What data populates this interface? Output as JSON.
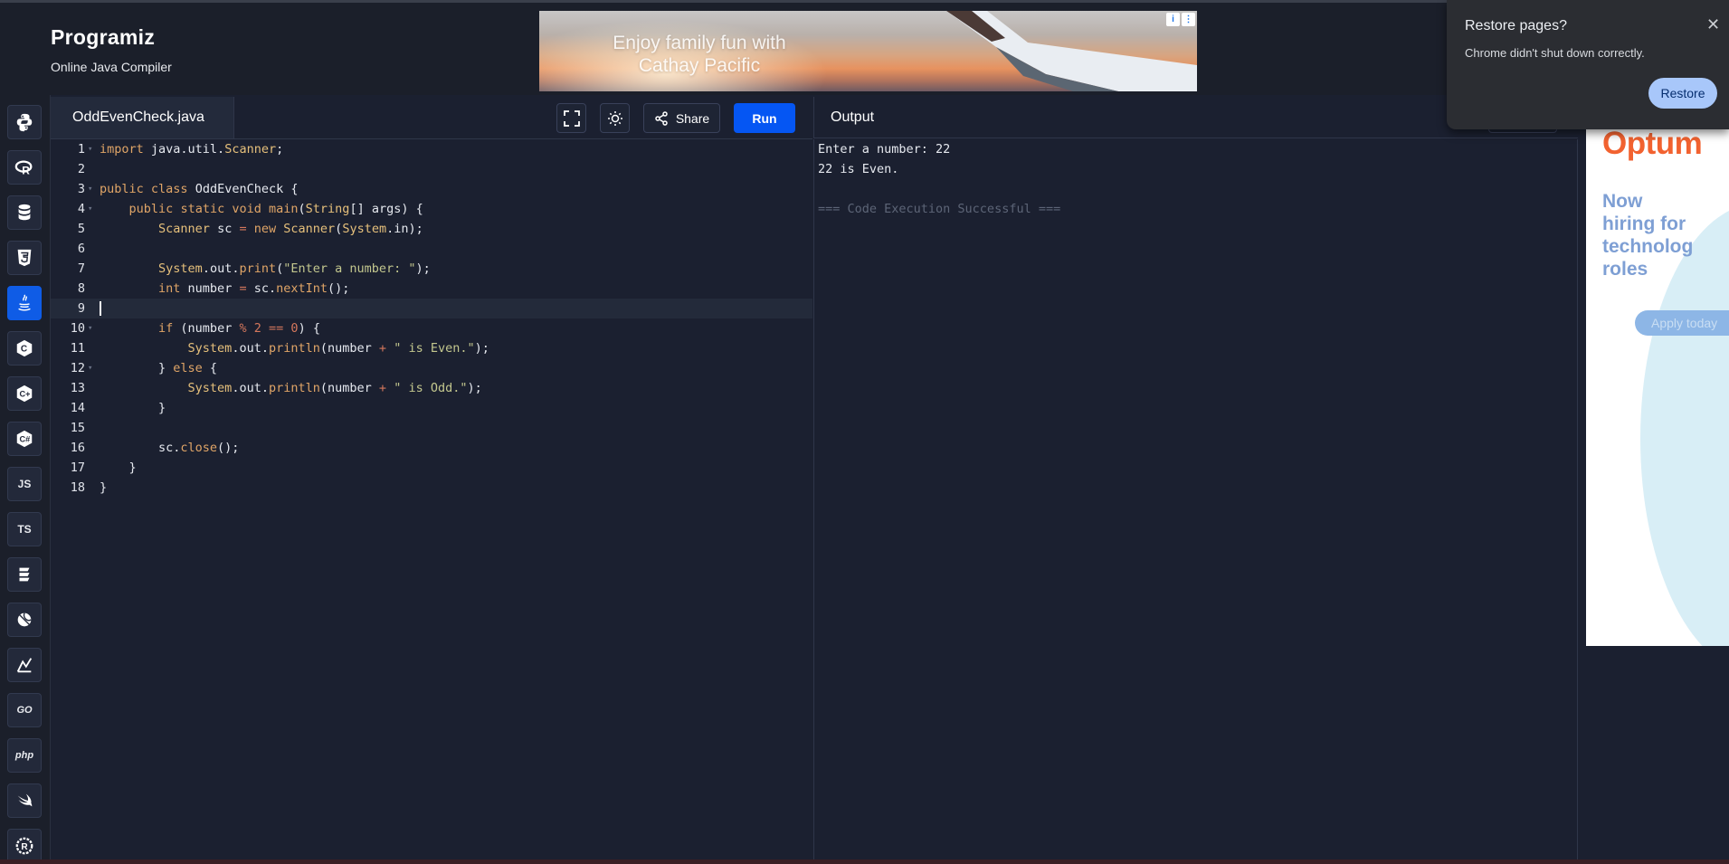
{
  "header": {
    "logo": "Programiz",
    "subtitle": "Online Java Compiler"
  },
  "top_ad": {
    "text_line1": "Enjoy family fun with",
    "text_line2": "Cathay Pacific"
  },
  "restore_popup": {
    "title": "Restore pages?",
    "message": "Chrome didn't shut down correctly.",
    "close": "✕",
    "button": "Restore"
  },
  "sidebar": {
    "languages": [
      {
        "name": "python",
        "label": ""
      },
      {
        "name": "r",
        "label": ""
      },
      {
        "name": "sql",
        "label": ""
      },
      {
        "name": "html",
        "label": ""
      },
      {
        "name": "java",
        "label": "",
        "active": true
      },
      {
        "name": "c",
        "label": ""
      },
      {
        "name": "cpp",
        "label": ""
      },
      {
        "name": "csharp",
        "label": ""
      },
      {
        "name": "javascript",
        "label": "JS"
      },
      {
        "name": "typescript",
        "label": "TS"
      },
      {
        "name": "kotlin",
        "label": ""
      },
      {
        "name": "dart",
        "label": ""
      },
      {
        "name": "rust-like",
        "label": ""
      },
      {
        "name": "go",
        "label": "GO"
      },
      {
        "name": "php",
        "label": "php"
      },
      {
        "name": "swift",
        "label": ""
      },
      {
        "name": "rust",
        "label": ""
      }
    ]
  },
  "editor": {
    "file_name": "OddEvenCheck.java",
    "share_label": "Share",
    "run_label": "Run",
    "current_line": 9,
    "lines": [
      "import java.util.Scanner;",
      "",
      "public class OddEvenCheck {",
      "    public static void main(String[] args) {",
      "        Scanner sc = new Scanner(System.in);",
      "",
      "        System.out.print(\"Enter a number: \");",
      "        int number = sc.nextInt();",
      "",
      "        if (number % 2 == 0) {",
      "            System.out.println(number + \" is Even.\");",
      "        } else {",
      "            System.out.println(number + \" is Odd.\");",
      "        }",
      "",
      "        sc.close();",
      "    }",
      "}"
    ]
  },
  "output": {
    "title": "Output",
    "lines": [
      "Enter a number: 22",
      "22 is Even.",
      "",
      "=== Code Execution Successful ==="
    ]
  },
  "right_ad": {
    "brand": "Optum",
    "copy_lines": [
      "Now",
      "hiring for",
      "technolog",
      "roles"
    ],
    "button": "Apply today"
  },
  "colors": {
    "accent": "#0556f3",
    "brand_orange": "#f26230",
    "restore_button": "#a8c7fa"
  }
}
